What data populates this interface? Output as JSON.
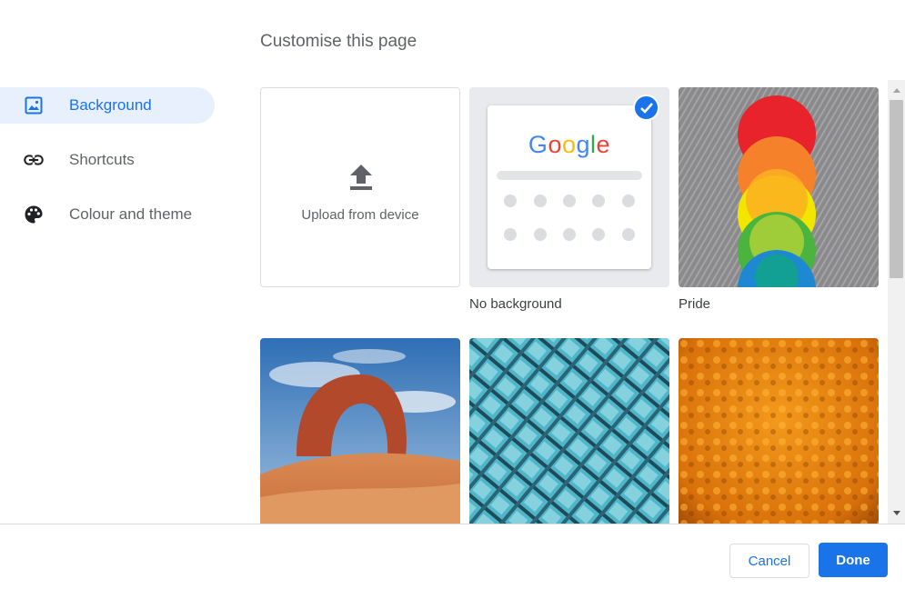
{
  "page": {
    "title": "Customise this page"
  },
  "sidebar": {
    "items": [
      {
        "label": "Background",
        "icon": "image-icon",
        "active": true
      },
      {
        "label": "Shortcuts",
        "icon": "link-icon"
      },
      {
        "label": "Colour and theme",
        "icon": "palette-icon"
      }
    ]
  },
  "backgrounds": {
    "upload_label": "Upload from device",
    "tiles": [
      {
        "caption": "No background",
        "selected": true
      },
      {
        "caption": "Pride"
      }
    ],
    "google_logo": [
      "G",
      "o",
      "o",
      "g",
      "l",
      "e"
    ],
    "google_colors": [
      "#4285f4",
      "#ea4335",
      "#fbbc05",
      "#4285f4",
      "#34a853",
      "#ea4335"
    ]
  },
  "footer": {
    "cancel_label": "Cancel",
    "done_label": "Done"
  },
  "colors": {
    "accent": "#1a73e8",
    "active_bg": "#e8f0fe"
  }
}
